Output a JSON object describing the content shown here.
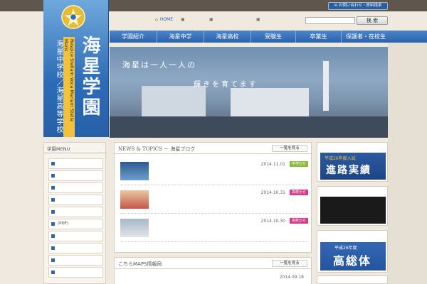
{
  "topbar": {
    "text": "",
    "contact_label": "お問い合わせ・資料請求"
  },
  "logo": {
    "main": "海星学園",
    "sub": "海星中学校／海星高等学校",
    "latin": "Respice Stellam Voca Mariam Stella Maris"
  },
  "toplinks": [
    {
      "label": "HOME",
      "icon": "home-icon"
    },
    {
      "label": "",
      "icon": "building-icon"
    },
    {
      "label": "",
      "icon": "building-icon"
    },
    {
      "label": "",
      "icon": "building-icon"
    }
  ],
  "search": {
    "placeholder": "",
    "button_label": "検 索"
  },
  "nav": [
    "学園紹介",
    "海星中学",
    "海星高校",
    "受験生",
    "卒業生",
    "保護者・在校生"
  ],
  "hero": {
    "line1": "海星は一人一人の",
    "line2": "輝きを育てます"
  },
  "left_menu": {
    "title": "学園MENU",
    "items": [
      "",
      "",
      "",
      "",
      "",
      "(PDF)",
      "",
      "",
      "",
      "",
      ""
    ]
  },
  "news": {
    "header": "NEWS & TOPICS － 海星ブログ",
    "more": "一覧を見る",
    "entries": [
      {
        "title": "",
        "date": "2014.11.01",
        "badge": "中学から",
        "badge_color": "#8bbd3a",
        "excerpt": ""
      },
      {
        "title": "",
        "date": "2014.10.31",
        "badge": "高校から",
        "badge_color": "#d83a8a",
        "excerpt": ""
      },
      {
        "title": "",
        "date": "2014.10.30",
        "badge": "高校から",
        "badge_color": "#d83a8a",
        "excerpt": ""
      }
    ]
  },
  "maps": {
    "header": "こちらMAPS情報局",
    "more": "一覧を見る",
    "first_date": "2014.09.18"
  },
  "right": {
    "box1_title": "",
    "banner1_line1": "平成26年度入試",
    "banner1_line2": "進路実績",
    "box2_title": "",
    "banner2_text": "",
    "banner3_line1": "平成26年度",
    "banner3_line2": "高総体",
    "box4_title": ""
  }
}
